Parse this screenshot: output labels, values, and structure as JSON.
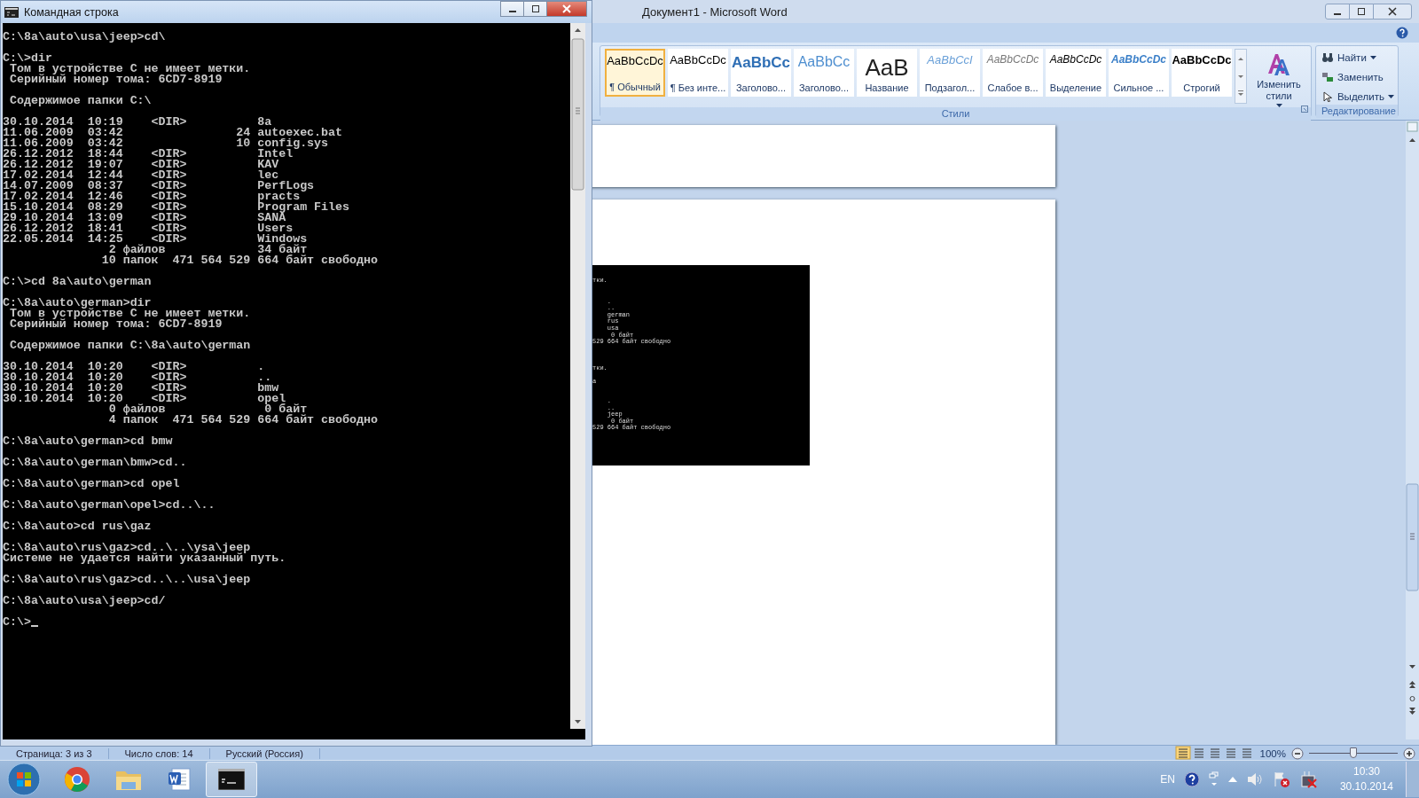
{
  "console": {
    "title": "Командная строка",
    "selected": true,
    "blocks": [
      [
        "C:\\8a\\auto\\usa\\jeep>cd\\"
      ],
      [
        "C:\\>dir",
        " Том в устройстве C не имеет метки.",
        " Серийный номер тома: 6CD7-8919"
      ],
      [
        " Содержимое папки C:\\"
      ],
      [
        "30.10.2014  10:19    <DIR>          8a",
        "11.06.2009  03:42                24 autoexec.bat",
        "11.06.2009  03:42                10 config.sys",
        "26.12.2012  18:44    <DIR>          Intel",
        "26.12.2012  19:07    <DIR>          KAV",
        "17.02.2014  12:44    <DIR>          lec",
        "14.07.2009  08:37    <DIR>          PerfLogs",
        "17.02.2014  12:46    <DIR>          practs",
        "15.10.2014  08:29    <DIR>          Program Files",
        "29.10.2014  13:09    <DIR>          SANA",
        "26.12.2012  18:41    <DIR>          Users",
        "22.05.2014  14:25    <DIR>          Windows",
        "               2 файлов             34 байт",
        "              10 папок  471 564 529 664 байт свободно"
      ],
      [
        "C:\\>cd 8a\\auto\\german"
      ],
      [
        "C:\\8a\\auto\\german>dir",
        " Том в устройстве C не имеет метки.",
        " Серийный номер тома: 6CD7-8919"
      ],
      [
        " Содержимое папки C:\\8a\\auto\\german"
      ],
      [
        "30.10.2014  10:20    <DIR>          .",
        "30.10.2014  10:20    <DIR>          ..",
        "30.10.2014  10:20    <DIR>          bmw",
        "30.10.2014  10:20    <DIR>          opel",
        "               0 файлов              0 байт",
        "               4 папок  471 564 529 664 байт свободно"
      ],
      [
        "C:\\8a\\auto\\german>cd bmw"
      ],
      [
        "C:\\8a\\auto\\german\\bmw>cd.."
      ],
      [
        "C:\\8a\\auto\\german>cd opel"
      ],
      [
        "C:\\8a\\auto\\german\\opel>cd..\\.."
      ],
      [
        "C:\\8a\\auto>cd rus\\gaz"
      ],
      [
        "C:\\8a\\auto\\rus\\gaz>cd..\\..\\ysa\\jeep",
        "Системе не удается найти указанный путь."
      ],
      [
        "C:\\8a\\auto\\rus\\gaz>cd..\\..\\usa\\jeep"
      ],
      [
        "C:\\8a\\auto\\usa\\jeep>cd/"
      ],
      [
        "C:\\>"
      ]
    ]
  },
  "word": {
    "title": "Документ1 - Microsoft Word",
    "selected": false,
    "styles": [
      {
        "preview": "AaBbCcDc",
        "label": "¶ Обычный",
        "selected": true
      },
      {
        "preview": "AaBbCcDc",
        "label": "¶ Без инте...",
        "selected": false
      },
      {
        "preview": "AaBbCc",
        "label": "Заголово...",
        "selected": false
      },
      {
        "preview": "AaBbCc",
        "label": "Заголово...",
        "selected": false
      },
      {
        "preview": "AaB",
        "label": "Название",
        "selected": false
      },
      {
        "preview": "AaBbCcI",
        "label": "Подзагол...",
        "selected": false
      },
      {
        "preview": "AaBbCcDc",
        "label": "Слабое в...",
        "selected": false
      },
      {
        "preview": "AaBbCcDc",
        "label": "Выделение",
        "selected": false
      },
      {
        "preview": "AaBbCcDc",
        "label": "Сильное ...",
        "selected": false
      },
      {
        "preview": "AaBbCcDc",
        "label": "Строгий",
        "selected": false
      }
    ],
    "change_styles": "Изменить стили",
    "styles_group": "Стили",
    "editing": [
      "Найти",
      "Заменить",
      "Выделить"
    ],
    "editing_group": "Редактирование",
    "embedded_screenshot": {
      "blocks": [
        [
          "тки."
        ],
        [
          "    .",
          "    ..",
          "    german",
          "    rus",
          "    usa",
          "     0 байт",
          "529 664 байт свободно"
        ],
        [
          "тки."
        ],
        [
          "а"
        ],
        [
          "    .",
          "    ..",
          "    jeep",
          "     0 байт",
          "529 664 байт свободно"
        ]
      ]
    },
    "status_bar": {
      "items": [
        "Страница: 3 из 3",
        "Число слов: 14",
        "Русский (Россия)"
      ],
      "zoom": "100%",
      "zoom_level": {
        "level": 0.5
      }
    }
  },
  "taskbar": {
    "apps": [
      {
        "kind": "browser",
        "selected": false
      },
      {
        "kind": "folder",
        "selected": false
      },
      {
        "kind": "word",
        "selected": false
      },
      {
        "kind": "console",
        "selected": true
      }
    ],
    "language": "EN",
    "time": "10:30",
    "date": "30.10.2014"
  }
}
